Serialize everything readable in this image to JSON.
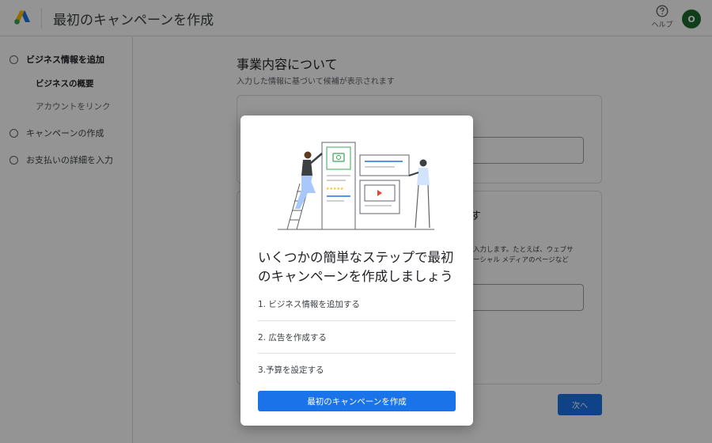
{
  "header": {
    "title": "最初のキャンペーンを作成",
    "help_label": "ヘルプ",
    "avatar_initial": "O"
  },
  "sidebar": {
    "steps": [
      {
        "label": "ビジネス情報を追加",
        "active": true
      },
      {
        "label": "キャンペーンの作成",
        "active": false
      },
      {
        "label": "お支払いの詳細を入力",
        "active": false
      }
    ],
    "substeps": [
      {
        "label": "ビジネスの概要",
        "active": true
      },
      {
        "label": "アカウントをリンク",
        "active": false
      }
    ]
  },
  "main": {
    "heading": "事業内容について",
    "subheading": "入力した情報に基づいて候補が表示されます",
    "card2_title_fragment": "す",
    "card2_desc_line1": "入力します。たとえば、ウェブサ",
    "card2_desc_line2": "ーシャル メディアのページなど",
    "next_label": "次へ"
  },
  "modal": {
    "title": "いくつかの簡単なステップで最初のキャンペーンを作成しましょう",
    "steps": [
      "1. ビジネス情報を追加する",
      "2. 広告を作成する",
      "3.予算を設定する"
    ],
    "cta_label": "最初のキャンペーンを作成"
  },
  "colors": {
    "accent": "#1a73e8",
    "avatar_bg": "#1e6b2e",
    "overlay": "rgba(0,0,0,0.42)"
  },
  "icons": [
    "google-ads-logo-icon",
    "help-circle-icon",
    "step-circle-icon"
  ]
}
